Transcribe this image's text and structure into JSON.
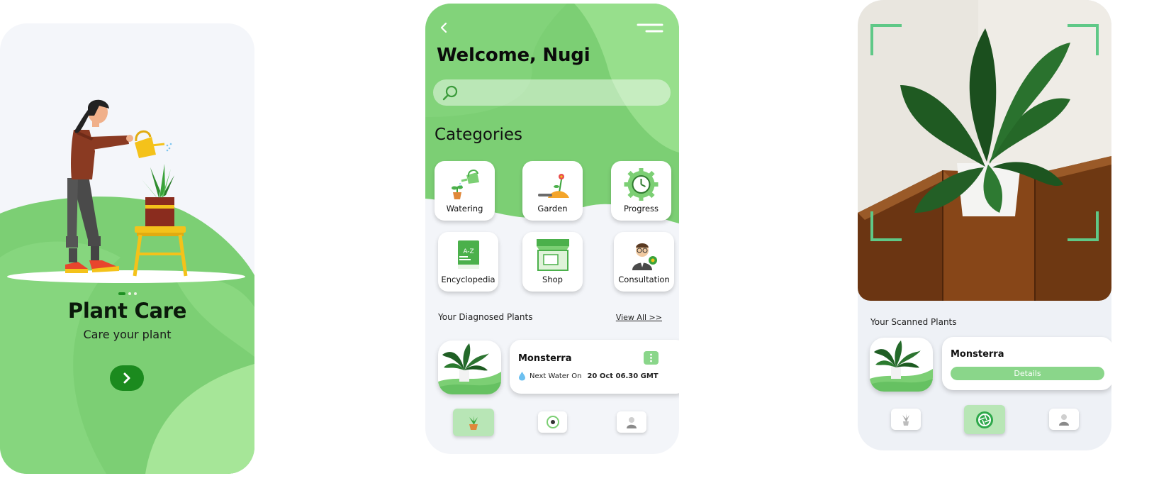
{
  "onboarding": {
    "title": "Plant Care",
    "subtitle": "Care your plant",
    "page_count": 3,
    "active_page": 1,
    "next_icon": "chevron-right-icon"
  },
  "home": {
    "welcome": "Welcome, Nugi",
    "search": {
      "placeholder": "",
      "value": ""
    },
    "categories_title": "Categories",
    "categories": [
      {
        "label": "Watering",
        "icon": "watering-can-icon"
      },
      {
        "label": "Garden",
        "icon": "garden-icon"
      },
      {
        "label": "Progress",
        "icon": "progress-clock-icon"
      },
      {
        "label": "Encyclopedia",
        "icon": "encyclopedia-book-icon"
      },
      {
        "label": "Shop",
        "icon": "shop-icon"
      },
      {
        "label": "Consultation",
        "icon": "consultant-icon"
      }
    ],
    "diagnosed_title": "Your Diagnosed Plants",
    "view_all": "View All >>",
    "plant": {
      "name": "Monsterra",
      "water_label": "Next Water On",
      "water_date": "20 Oct 06.30 GMT"
    },
    "nav": [
      {
        "icon": "potted-plant-icon",
        "active": true
      },
      {
        "icon": "scan-icon",
        "active": false
      },
      {
        "icon": "profile-icon",
        "active": false
      }
    ]
  },
  "scan": {
    "scanned_title": "Your Scanned Plants",
    "plant": {
      "name": "Monsterra",
      "details_label": "Details"
    },
    "nav": [
      {
        "icon": "succulent-icon",
        "active": false
      },
      {
        "icon": "scan-aperture-icon",
        "active": true
      },
      {
        "icon": "profile-icon",
        "active": false
      }
    ]
  },
  "colors": {
    "brand_green": "#1b8a1e",
    "light_green": "#8ad68a",
    "mid_green": "#7ccf74",
    "pale_green": "#a3e597",
    "background": "#f3f5f9"
  }
}
